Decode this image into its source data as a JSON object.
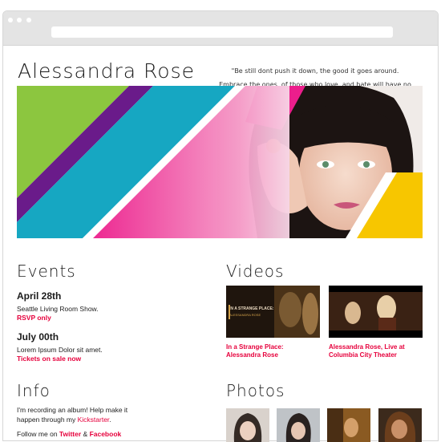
{
  "site": {
    "title": "Alessandra Rose",
    "quote": "\"Be still dont push it down, the good it goes around. Embrace the ones, of those who love, and hate will have no one.\""
  },
  "events": {
    "heading": "Events",
    "items": [
      {
        "date": "April 28th",
        "description": "Seattle Living Room Show.",
        "link": "RSVP only"
      },
      {
        "date": "July 00th",
        "description": "Lorem Ipsum Dolor sit amet.",
        "link": "Tickets on sale now"
      }
    ]
  },
  "videos": {
    "heading": "Videos",
    "items": [
      {
        "thumb_text": "IN A STRANGE PLACE:",
        "thumb_subtext": "ALESSANDRA ROSE",
        "caption_line1": "In a Strange Place:",
        "caption_line2": "Alessandra Rose"
      },
      {
        "caption_line1": "Alessandra Rose, Live at",
        "caption_line2": "Columbia City Theater"
      }
    ]
  },
  "info": {
    "heading": "Info",
    "line1": "I'm recording an album! Help make it",
    "line2_prefix": "happen through my ",
    "line2_link": "Kickstarter",
    "line2_suffix": ".",
    "line3_prefix": "Follow me on ",
    "line3_link1": "Twitter",
    "line3_mid": " & ",
    "line3_link2": "Facebook"
  },
  "photos": {
    "heading": "Photos"
  },
  "colors": {
    "accent_red": "#e6003c",
    "lime": "#8cc63f",
    "purple": "#6a1b8a",
    "teal": "#16a7c2",
    "magenta": "#ec1e8c",
    "yellow": "#f7c600"
  }
}
